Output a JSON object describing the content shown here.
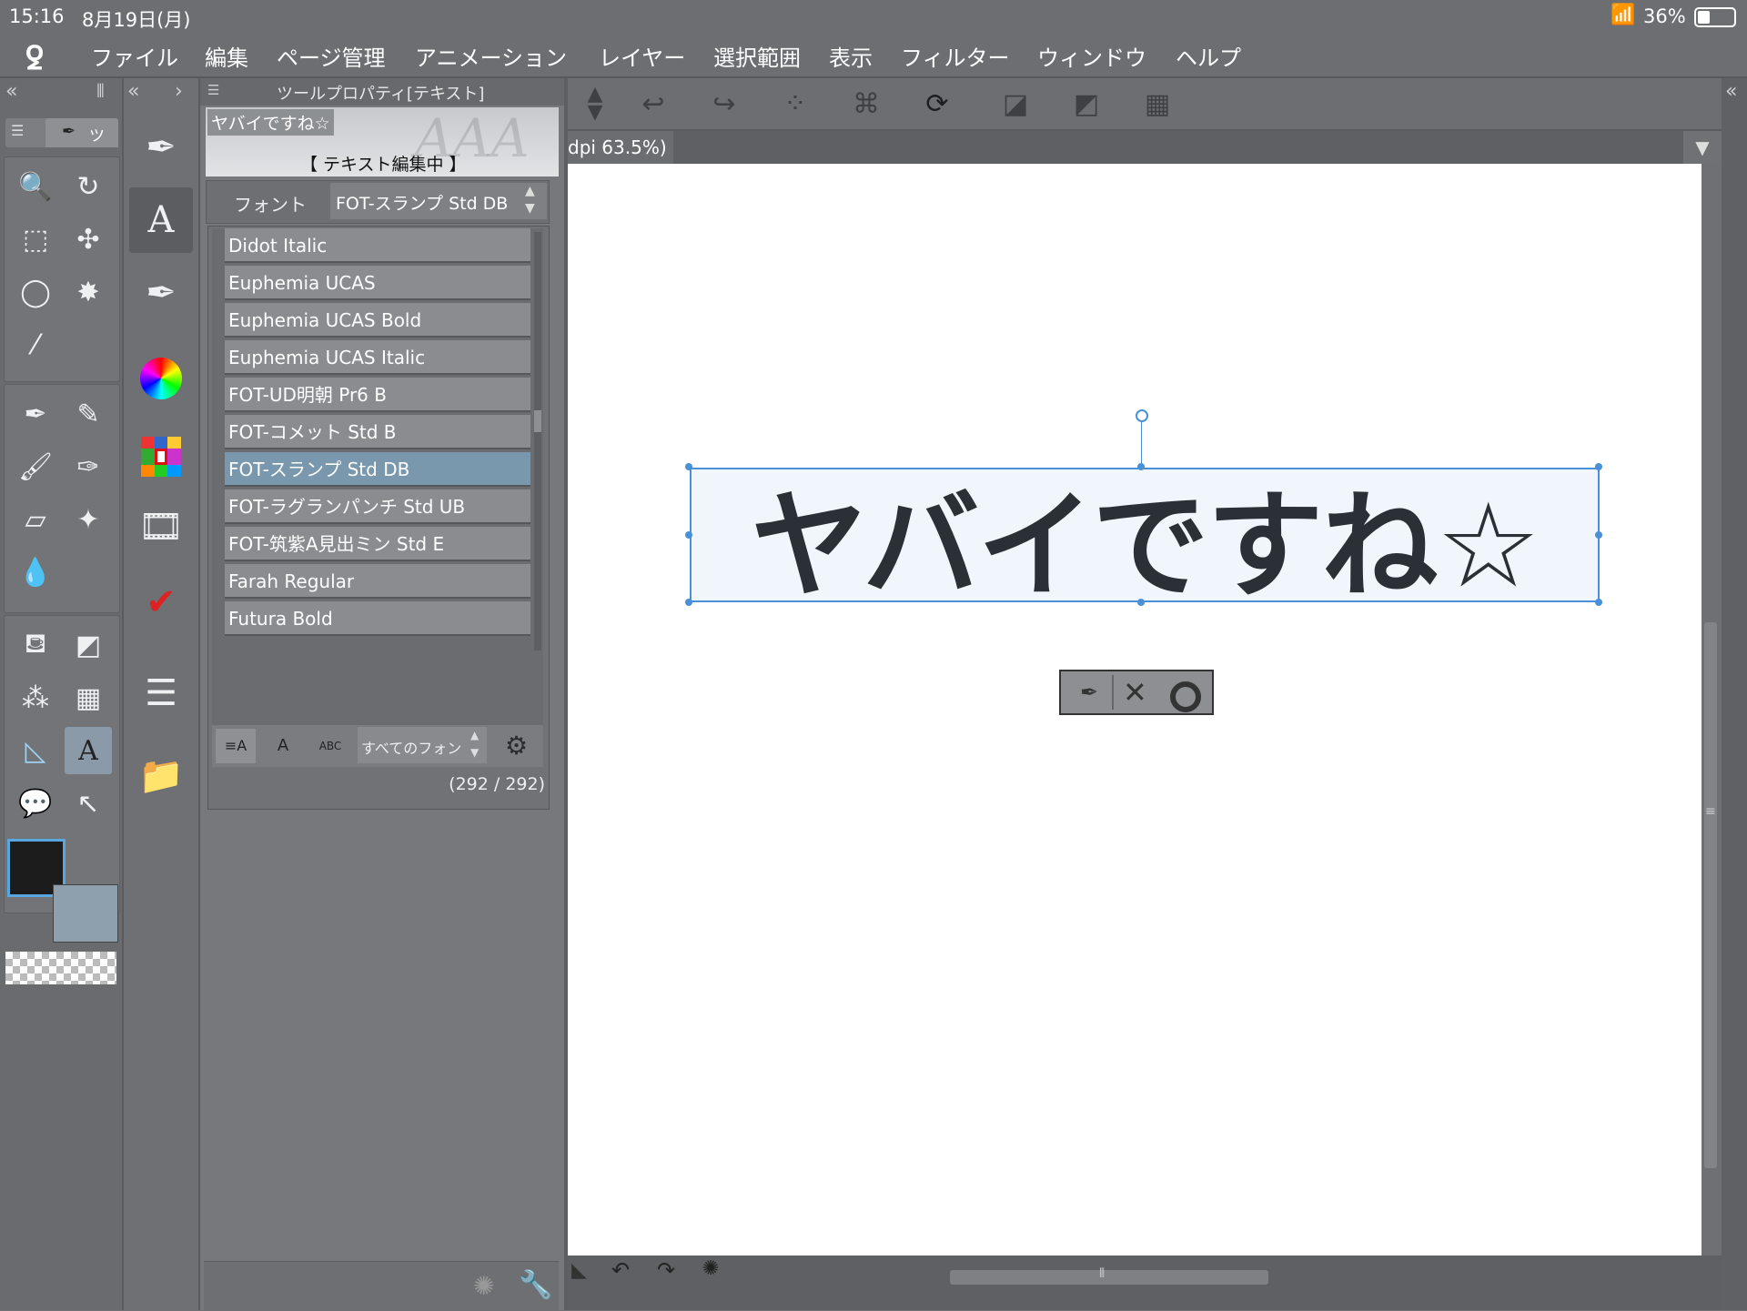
{
  "status": {
    "time": "15:16",
    "date": "8月19日(月)",
    "battery": "36%"
  },
  "menu": [
    "ファイル",
    "編集",
    "ページ管理",
    "アニメーション",
    "レイヤー",
    "選択範囲",
    "表示",
    "フィルター",
    "ウィンドウ",
    "ヘルプ"
  ],
  "toolbox": {
    "tab_label": "ツー"
  },
  "toolprop": {
    "title": "ツールプロパティ[テキスト]",
    "preview_text": "ヤバイですね☆",
    "editing_label": "【 テキスト編集中 】",
    "font_label": "フォント",
    "font_value": "FOT-スランプ Std DB",
    "font_list": [
      "Didot Italic",
      "Euphemia UCAS",
      "Euphemia UCAS Bold",
      "Euphemia UCAS Italic",
      "FOT-UD明朝 Pr6 B",
      "FOT-コメット Std B",
      "FOT-スランプ Std DB",
      "FOT-ラグランパンチ Std UB",
      "FOT-筑紫A見出ミン Std E",
      "Farah Regular",
      "Futura Bold"
    ],
    "selected_font_index": 6,
    "filter_value": "すべてのフォン",
    "count": "(292 / 292)"
  },
  "canvas": {
    "tab_label": "dpi 63.5%)",
    "text": "ヤバイですね☆"
  },
  "colors": {
    "main": "#1c1c1c",
    "sub": "#8ea0ad",
    "accent": "#4a90d9",
    "selected_row": "#7a98ad"
  }
}
